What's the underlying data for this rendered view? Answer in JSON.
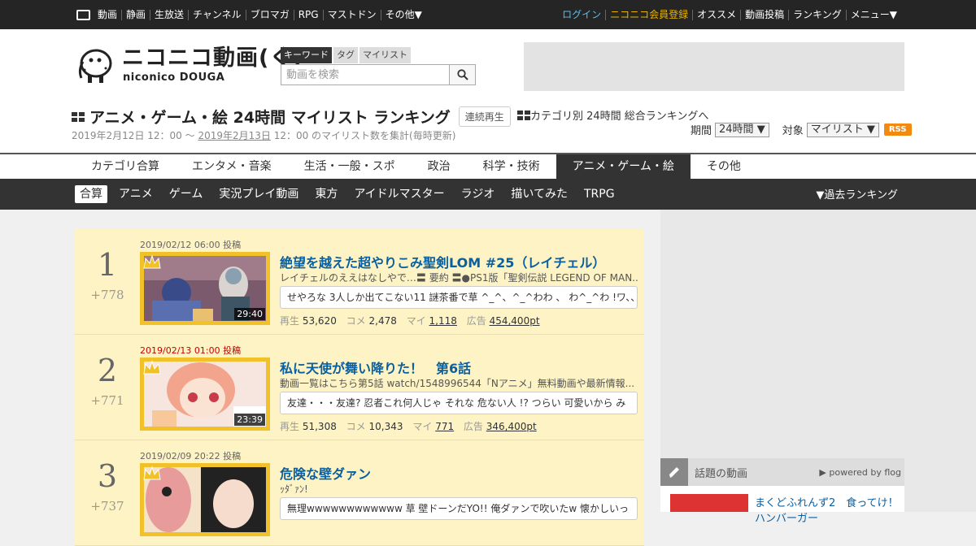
{
  "topbar": {
    "left_items": [
      "動画",
      "静画",
      "生放送",
      "チャンネル",
      "ブロマガ",
      "RPG",
      "マストドン",
      "その他▼"
    ],
    "login": "ログイン",
    "signup": "ニコニコ会員登録",
    "right_items": [
      "オススメ",
      "動画投稿",
      "ランキング",
      "メニュー▼"
    ]
  },
  "logo": {
    "jp": "ニコニコ動画(く)",
    "en": "niconico DOUGA"
  },
  "search": {
    "tabs": [
      "キーワード",
      "タグ",
      "マイリスト"
    ],
    "placeholder": "動画を検索"
  },
  "ranking": {
    "title": "アニメ・ゲーム・絵 24時間 マイリスト ランキング",
    "continuous_play": "連続再生",
    "category_link": "カテゴリ別 24時間 総合ランキングへ",
    "period_start": "2019年2月12日 12：00 ～ ",
    "period_end_link": "2019年2月13日",
    "period_end_rest": " 12：00 のマイリスト数を集計(毎時更新)",
    "period_label": "期間",
    "period_value": "24時間 ▼",
    "target_label": "対象",
    "target_value": "マイリスト ▼",
    "rss": "RSS"
  },
  "category_tabs": [
    "カテゴリ合算",
    "エンタメ・音楽",
    "生活・一般・スポ",
    "政治",
    "科学・技術",
    "アニメ・ゲーム・絵",
    "その他"
  ],
  "active_category": "アニメ・ゲーム・絵",
  "sub_tabs": [
    "合算",
    "アニメ",
    "ゲーム",
    "実況プレイ動画",
    "東方",
    "アイドルマスター",
    "ラジオ",
    "描いてみた",
    "TRPG"
  ],
  "past_ranking": "▼過去ランキング",
  "items": [
    {
      "rank": "1",
      "diff": "+778",
      "date": "2019/02/12 06:00 投稿",
      "duration": "29:40",
      "title": "絶望を越えた超やりこみ聖剣LOM #25（レイチェル）",
      "desc": "レイチェルのええはなしやで…〓 要約 〓●PS1版「聖剣伝説 LEGEND OF MAN...",
      "comment": "せやろな 3人しか出てこない11 謎茶番で草 ^_^、^_^わわ 、 わ^_^わ !ワ、、",
      "views_label": "再生",
      "views": "53,620",
      "comments_label": "コメ",
      "comments": "2,478",
      "mylist_label": "マイ",
      "mylist": "1,118",
      "ad_label": "広告",
      "ad": "454,400pt"
    },
    {
      "rank": "2",
      "diff": "+771",
      "date": "2019/02/13 01:00 投稿",
      "duration": "23:39",
      "title": "私に天使が舞い降りた！　第6話",
      "desc": "動画一覧はこちら第5話 watch/1548996544「Nアニメ」無料動画や最新情報...",
      "comment": "友達・・・友達? 忍者これ何人じゃ それな 危ない人 !? つらい 可愛いから み",
      "views_label": "再生",
      "views": "51,308",
      "comments_label": "コメ",
      "comments": "10,343",
      "mylist_label": "マイ",
      "mylist": "771",
      "ad_label": "広告",
      "ad": "346,400pt"
    },
    {
      "rank": "3",
      "diff": "+737",
      "date": "2019/02/09 20:22 投稿",
      "duration": "",
      "title": "危険な壁ダァン",
      "desc": "ｯﾀﾞｧﾝ!",
      "comment": "無理wwwwwwwwwwww 草 壁ドーンだYO!! 俺ダァンで吹いたw 懐かしいっ",
      "views_label": "",
      "views": "",
      "comments_label": "",
      "comments": "",
      "mylist_label": "",
      "mylist": "",
      "ad_label": "",
      "ad": ""
    }
  ],
  "hot": {
    "label": "話題の動画",
    "powered": "▶ powered by flog",
    "item_title": "まくどふれんず2　食ってけ！ハンバーガー"
  }
}
